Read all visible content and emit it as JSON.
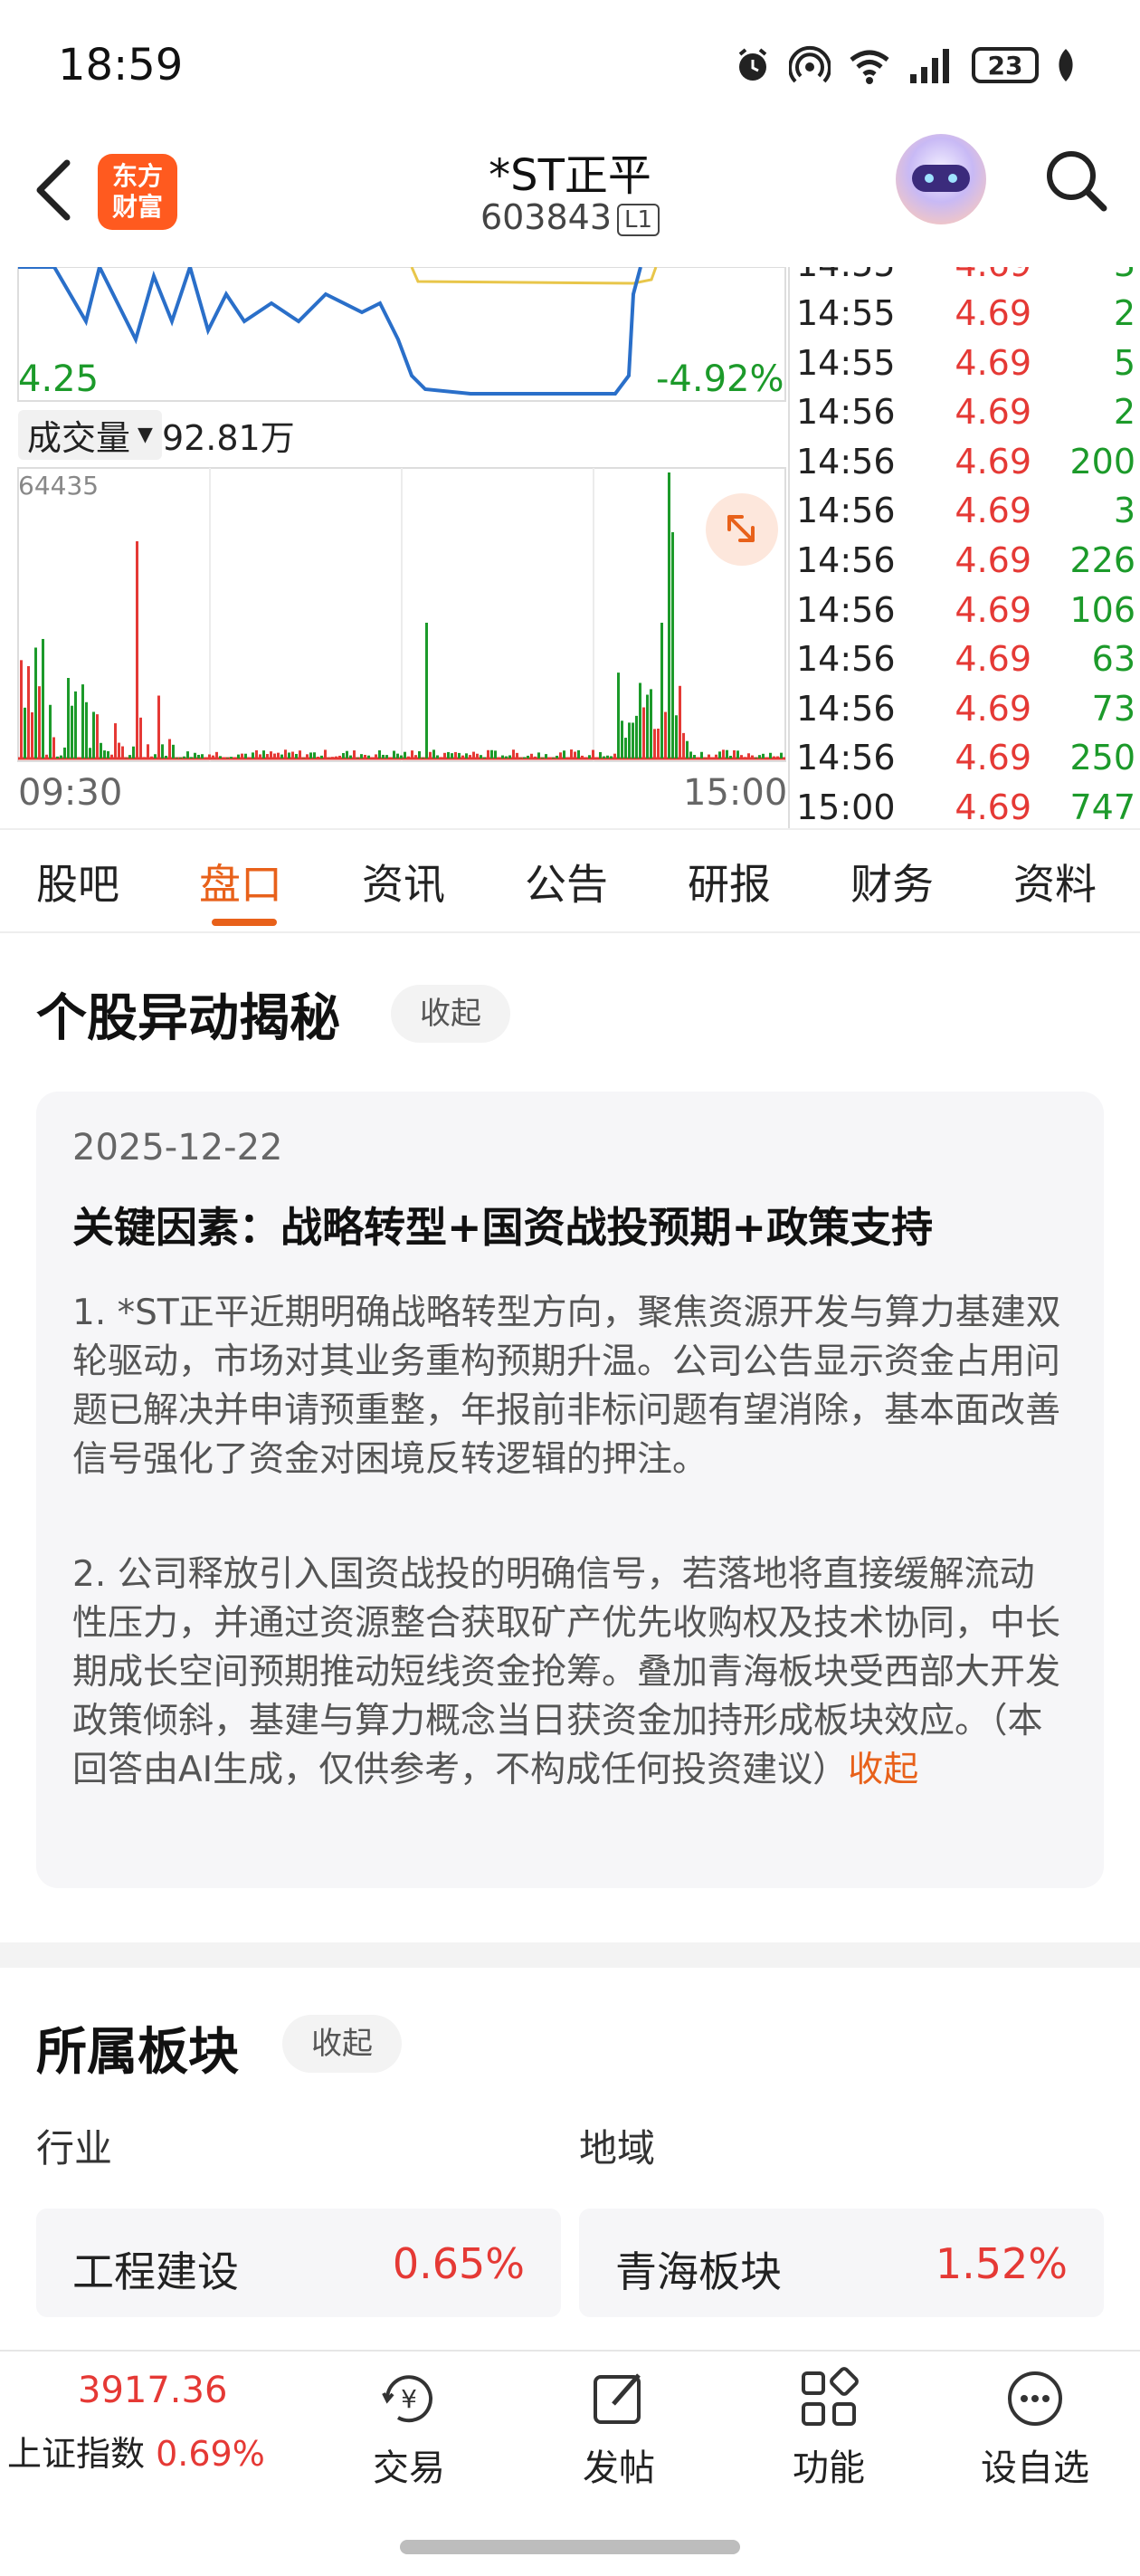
{
  "status": {
    "time": "18:59",
    "battery": "23",
    "signal_sup": "1",
    "wifi_sup": "6"
  },
  "header": {
    "title": "*ST正平",
    "code": "603843",
    "level": "L1",
    "logo_text": "东方财富"
  },
  "chart": {
    "price_low": "4.25",
    "pct_low": "-4.92%",
    "volume_label": "成交量",
    "volume_value": "92.81万",
    "volume_max": "64435",
    "time_start": "09:30",
    "time_end": "15:00"
  },
  "ticks": [
    {
      "time": "14:55",
      "price": "4.69",
      "vol": "2"
    },
    {
      "time": "14:55",
      "price": "4.69",
      "vol": "5"
    },
    {
      "time": "14:56",
      "price": "4.69",
      "vol": "2"
    },
    {
      "time": "14:56",
      "price": "4.69",
      "vol": "200"
    },
    {
      "time": "14:56",
      "price": "4.69",
      "vol": "3"
    },
    {
      "time": "14:56",
      "price": "4.69",
      "vol": "226"
    },
    {
      "time": "14:56",
      "price": "4.69",
      "vol": "106"
    },
    {
      "time": "14:56",
      "price": "4.69",
      "vol": "63"
    },
    {
      "time": "14:56",
      "price": "4.69",
      "vol": "73"
    },
    {
      "time": "14:56",
      "price": "4.69",
      "vol": "250"
    },
    {
      "time": "15:00",
      "price": "4.69",
      "vol": "747"
    }
  ],
  "tabs": [
    "股吧",
    "盘口",
    "资讯",
    "公告",
    "研报",
    "财务",
    "资料"
  ],
  "active_tab": "盘口",
  "anomaly": {
    "title": "个股异动揭秘",
    "collapse": "收起",
    "date": "2025-12-22",
    "headline": "关键因素：战略转型+国资战投预期+政策支持",
    "p1": "1. *ST正平近期明确战略转型方向，聚焦资源开发与算力基建双轮驱动，市场对其业务重构预期升温。公司公告显示资金占用问题已解决并申请预重整，年报前非标问题有望消除，基本面改善信号强化了资金对困境反转逻辑的押注。",
    "p2": "2. 公司释放引入国资战投的明确信号，若落地将直接缓解流动性压力，并通过资源整合获取矿产优先收购权及技术协同，中长期成长空间预期推动短线资金抢筹。叠加青海板块受西部大开发政策倾斜，基建与算力概念当日获资金加持形成板块效应。（本回答由AI生成，仅供参考，不构成任何投资建议）",
    "p2_link": "收起"
  },
  "sectors": {
    "title": "所属板块",
    "collapse": "收起",
    "industry_label": "行业",
    "region_label": "地域",
    "industry": {
      "name": "工程建设",
      "pct": "0.65%"
    },
    "region": {
      "name": "青海板块",
      "pct": "1.52%"
    }
  },
  "bottom_nav": {
    "index_value": "3917.36",
    "index_name": "上证指数",
    "index_pct": "0.69%",
    "items": [
      "交易",
      "发帖",
      "功能",
      "设自选"
    ]
  }
}
